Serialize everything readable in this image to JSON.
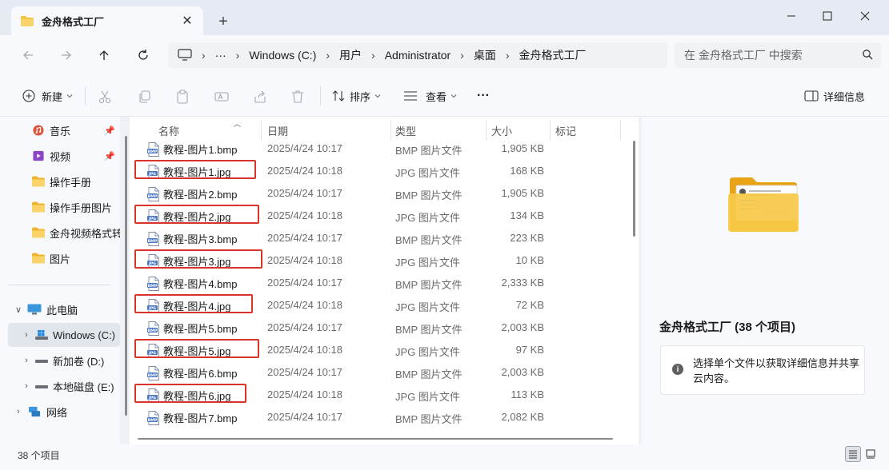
{
  "window": {
    "tab_title": "金舟格式工厂",
    "tab_close": "✕",
    "new_tab": "+"
  },
  "address": {
    "more": "···",
    "crumbs": [
      "Windows (C:)",
      "用户",
      "Administrator",
      "桌面",
      "金舟格式工厂"
    ],
    "separator": "›",
    "search_placeholder": "在 金舟格式工厂 中搜索"
  },
  "toolbar": {
    "new_label": "新建",
    "sort_label": "排序",
    "view_label": "查看",
    "more_label": "···",
    "details_label": "详细信息"
  },
  "sidebar": {
    "items": [
      {
        "label": "音乐",
        "icon": "music-icon",
        "pinned": true
      },
      {
        "label": "视频",
        "icon": "video-icon",
        "pinned": true
      },
      {
        "label": "操作手册",
        "icon": "folder-icon"
      },
      {
        "label": "操作手册图片",
        "icon": "folder-icon"
      },
      {
        "label": "金舟视频格式转",
        "icon": "folder-icon"
      },
      {
        "label": "图片",
        "icon": "folder-icon"
      },
      {
        "label": "此电脑",
        "icon": "computer-icon",
        "expanded": true
      },
      {
        "label": "Windows (C:)",
        "icon": "drive-icon",
        "selected": true
      },
      {
        "label": "新加卷 (D:)",
        "icon": "drive-icon"
      },
      {
        "label": "本地磁盘 (E:)",
        "icon": "drive-icon"
      },
      {
        "label": "网络",
        "icon": "network-icon"
      }
    ]
  },
  "file_list": {
    "columns": {
      "name": "名称",
      "date": "日期",
      "type": "类型",
      "size": "大小",
      "tags": "标记"
    },
    "rows": [
      {
        "name": "教程-图片1.bmp",
        "date": "2025/4/24 10:17",
        "type": "BMP 图片文件",
        "size": "1,905 KB",
        "ext": "BMP",
        "highlighted": false
      },
      {
        "name": "教程-图片1.jpg",
        "date": "2025/4/24 10:18",
        "type": "JPG 图片文件",
        "size": "168 KB",
        "ext": "JPG",
        "highlighted": true
      },
      {
        "name": "教程-图片2.bmp",
        "date": "2025/4/24 10:17",
        "type": "BMP 图片文件",
        "size": "1,905 KB",
        "ext": "BMP",
        "highlighted": false
      },
      {
        "name": "教程-图片2.jpg",
        "date": "2025/4/24 10:18",
        "type": "JPG 图片文件",
        "size": "134 KB",
        "ext": "JPG",
        "highlighted": true
      },
      {
        "name": "教程-图片3.bmp",
        "date": "2025/4/24 10:17",
        "type": "BMP 图片文件",
        "size": "223 KB",
        "ext": "BMP",
        "highlighted": false
      },
      {
        "name": "教程-图片3.jpg",
        "date": "2025/4/24 10:18",
        "type": "JPG 图片文件",
        "size": "10 KB",
        "ext": "JPG",
        "highlighted": true
      },
      {
        "name": "教程-图片4.bmp",
        "date": "2025/4/24 10:17",
        "type": "BMP 图片文件",
        "size": "2,333 KB",
        "ext": "BMP",
        "highlighted": false
      },
      {
        "name": "教程-图片4.jpg",
        "date": "2025/4/24 10:18",
        "type": "JPG 图片文件",
        "size": "72 KB",
        "ext": "JPG",
        "highlighted": true
      },
      {
        "name": "教程-图片5.bmp",
        "date": "2025/4/24 10:17",
        "type": "BMP 图片文件",
        "size": "2,003 KB",
        "ext": "BMP",
        "highlighted": false
      },
      {
        "name": "教程-图片5.jpg",
        "date": "2025/4/24 10:18",
        "type": "JPG 图片文件",
        "size": "97 KB",
        "ext": "JPG",
        "highlighted": true
      },
      {
        "name": "教程-图片6.bmp",
        "date": "2025/4/24 10:17",
        "type": "BMP 图片文件",
        "size": "2,003 KB",
        "ext": "BMP",
        "highlighted": false
      },
      {
        "name": "教程-图片6.jpg",
        "date": "2025/4/24 10:18",
        "type": "JPG 图片文件",
        "size": "113 KB",
        "ext": "JPG",
        "highlighted": true
      },
      {
        "name": "教程-图片7.bmp",
        "date": "2025/4/24 10:17",
        "type": "BMP 图片文件",
        "size": "2,082 KB",
        "ext": "BMP",
        "highlighted": false
      }
    ]
  },
  "details_pane": {
    "title": "金舟格式工厂 (38 个项目)",
    "info_icon": "i",
    "info": "选择单个文件以获取详细信息并共享云内容。"
  },
  "status": {
    "item_count": "38 个项目"
  },
  "colors": {
    "highlight_border": "#d9342b",
    "folder_yellow": "#f5c542",
    "accent": "#0067c0"
  }
}
